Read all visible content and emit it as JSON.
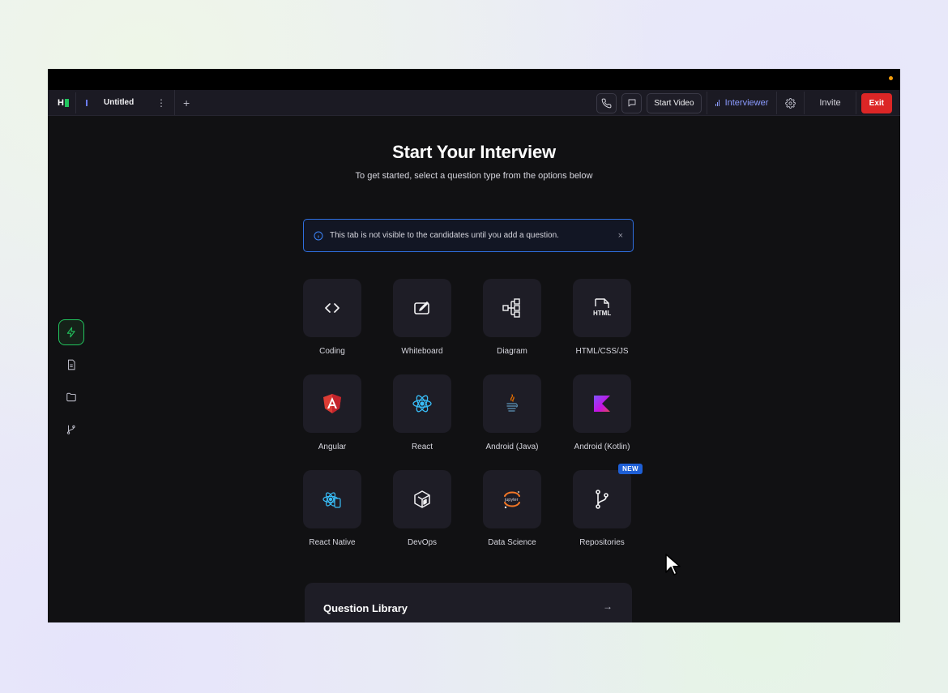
{
  "header": {
    "tab_name": "Untitled",
    "tab_menu": "⋮",
    "add_tab": "+",
    "start_video": "Start Video",
    "role": "Interviewer",
    "invite": "Invite",
    "exit": "Exit"
  },
  "main": {
    "title": "Start Your Interview",
    "subtitle": "To get started, select a question type from the options below",
    "info_banner": "This tab is not visible to the candidates until you add a question.",
    "info_close": "×"
  },
  "question_types": [
    {
      "label": "Coding",
      "icon": "code-icon"
    },
    {
      "label": "Whiteboard",
      "icon": "whiteboard-icon"
    },
    {
      "label": "Diagram",
      "icon": "diagram-icon"
    },
    {
      "label": "HTML/CSS/JS",
      "icon": "html-file-icon"
    },
    {
      "label": "Angular",
      "icon": "angular-icon"
    },
    {
      "label": "React",
      "icon": "react-icon"
    },
    {
      "label": "Android (Java)",
      "icon": "java-icon"
    },
    {
      "label": "Android (Kotlin)",
      "icon": "kotlin-icon"
    },
    {
      "label": "React Native",
      "icon": "react-native-icon"
    },
    {
      "label": "DevOps",
      "icon": "devops-cube-icon"
    },
    {
      "label": "Data Science",
      "icon": "jupyter-icon"
    },
    {
      "label": "Repositories",
      "icon": "git-branch-icon",
      "badge": "NEW"
    }
  ],
  "library": {
    "title": "Question Library",
    "arrow": "→"
  },
  "colors": {
    "accent_green": "#22c55e",
    "exit_red": "#dc2626",
    "interviewer_blue": "#8b9bff",
    "banner_border": "#2f6fe0",
    "badge_blue": "#1e5fd6"
  }
}
